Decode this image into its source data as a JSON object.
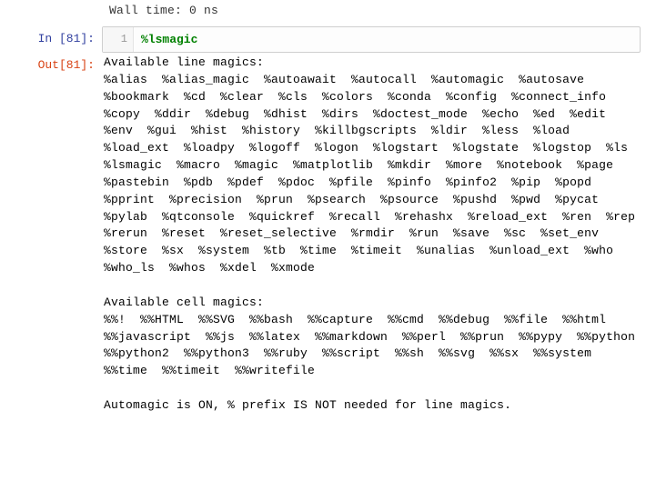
{
  "partial_top_line": "Wall time: 0 ns",
  "in_prompt": "In [81]:",
  "out_prompt": "Out[81]:",
  "gutter_line": "1",
  "code": "%lsmagic",
  "output": "Available line magics:\n%alias  %alias_magic  %autoawait  %autocall  %automagic  %autosave  %bookmark  %cd  %clear  %cls  %colors  %conda  %config  %connect_info  %copy  %ddir  %debug  %dhist  %dirs  %doctest_mode  %echo  %ed  %edit  %env  %gui  %hist  %history  %killbgscripts  %ldir  %less  %load  %load_ext  %loadpy  %logoff  %logon  %logstart  %logstate  %logstop  %ls  %lsmagic  %macro  %magic  %matplotlib  %mkdir  %more  %notebook  %page  %pastebin  %pdb  %pdef  %pdoc  %pfile  %pinfo  %pinfo2  %pip  %popd  %pprint  %precision  %prun  %psearch  %psource  %pushd  %pwd  %pycat  %pylab  %qtconsole  %quickref  %recall  %rehashx  %reload_ext  %ren  %rep  %rerun  %reset  %reset_selective  %rmdir  %run  %save  %sc  %set_env  %store  %sx  %system  %tb  %time  %timeit  %unalias  %unload_ext  %who  %who_ls  %whos  %xdel  %xmode\n\nAvailable cell magics:\n%%!  %%HTML  %%SVG  %%bash  %%capture  %%cmd  %%debug  %%file  %%html  %%javascript  %%js  %%latex  %%markdown  %%perl  %%prun  %%pypy  %%python  %%python2  %%python3  %%ruby  %%script  %%sh  %%svg  %%sx  %%system  %%time  %%timeit  %%writefile\n\nAutomagic is ON, % prefix IS NOT needed for line magics."
}
